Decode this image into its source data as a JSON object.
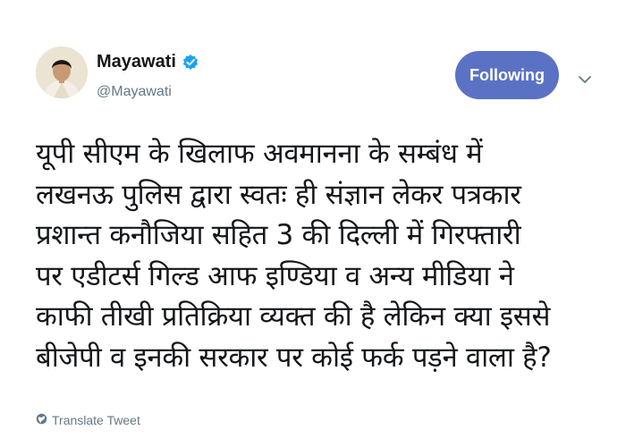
{
  "user": {
    "display_name": "Mayawati",
    "handle": "@Mayawati"
  },
  "follow_button": {
    "label": "Following"
  },
  "tweet": {
    "lines": [
      "यूपी सीएम के खिलाफ अवमानना के सम्बंध में",
      "लखनऊ पुलिस द्वारा स्वतः ही संज्ञान लेकर पत्रकार",
      "प्रशान्त कनौजिया सहित 3 की दिल्ली में गिरफ्तारी",
      "पर एडीटर्स गिल्ड आफ इण्डिया व अन्य मीडिया ने",
      "काफी तीखी प्रतिक्रिया व्यक्त की है लेकिन क्या इससे",
      "बीजेपी व इनकी सरकार पर कोई फर्क पड़ने वाला है?"
    ]
  },
  "translate": {
    "label": "Translate Tweet",
    "icon": "globe-icon"
  },
  "icons": {
    "verified": "verified-badge-icon",
    "caret": "chevron-down-icon"
  },
  "colors": {
    "follow_button": "#5b72c4",
    "verified": "#1da1f2",
    "secondary_text": "#657786"
  }
}
